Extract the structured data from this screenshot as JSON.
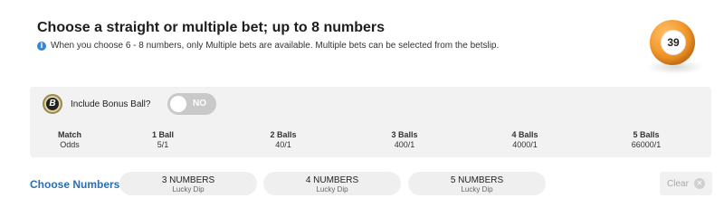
{
  "header": {
    "title": "Choose a straight or multiple bet; up to 8 numbers",
    "info_icon": "info-icon",
    "info_text": "When you choose 6 - 8 numbers, only Multiple bets are available. Multiple bets can be selected from the betslip."
  },
  "ball": {
    "number": "39",
    "color": "#f39a2b"
  },
  "bonus": {
    "icon_letter": "B",
    "label": "Include Bonus Ball?",
    "toggle_state": "NO"
  },
  "odds": {
    "match": {
      "head": "Match",
      "value": "Odds"
    },
    "columns": [
      {
        "head": "1 Ball",
        "value": "5/1"
      },
      {
        "head": "2 Balls",
        "value": "40/1"
      },
      {
        "head": "3 Balls",
        "value": "400/1"
      },
      {
        "head": "4 Balls",
        "value": "4000/1"
      },
      {
        "head": "5 Balls",
        "value": "66000/1"
      }
    ]
  },
  "choose": {
    "label": "Choose Numbers",
    "buttons": [
      {
        "main": "3 NUMBERS",
        "sub": "Lucky Dip"
      },
      {
        "main": "4 NUMBERS",
        "sub": "Lucky Dip"
      },
      {
        "main": "5 NUMBERS",
        "sub": "Lucky Dip"
      }
    ],
    "clear_label": "Clear"
  },
  "colors": {
    "accent_blue": "#2a6db3",
    "info_blue": "#3a86d4",
    "panel_bg": "#f2f2f2"
  }
}
